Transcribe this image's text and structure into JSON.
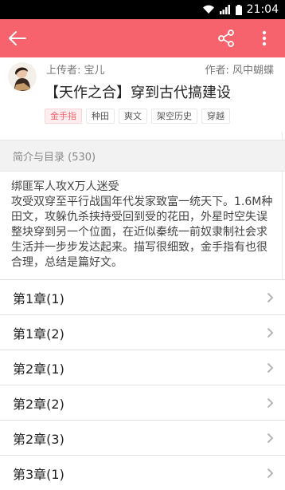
{
  "statusbar": {
    "time": "21:04",
    "icons": [
      "wifi-icon",
      "signal-icon",
      "battery-icon"
    ]
  },
  "appbar": {
    "color": "#f6636d",
    "icons": [
      "back-arrow-icon",
      "share-icon",
      "more-vert-icon"
    ]
  },
  "book": {
    "uploader": "上传者: 宝儿",
    "author": "作者: 风中蝴蝶",
    "title": "【天作之合】穿到古代搞建设",
    "tags": [
      "金手指",
      "种田",
      "爽文",
      "架空历史",
      "穿越"
    ]
  },
  "section": {
    "label": "简介与目录 (530)"
  },
  "description": {
    "first_line": "绑匪军人攻X万人迷受",
    "body": "攻受双穿至平行战国年代发家致富一统天下。1.6M种田文，攻躲仇杀挟持受回到受的花田，外星时空失误整块穿到另一个位面，在近似秦统一前奴隶制社会求生活并一步步发达起来。描写很细致，金手指有也很合理，总结是篇好文。"
  },
  "chapters": [
    {
      "label": "第1章(1)"
    },
    {
      "label": "第1章(2)"
    },
    {
      "label": "第2章(1)"
    },
    {
      "label": "第2章(2)"
    },
    {
      "label": "第2章(3)"
    },
    {
      "label": "第3章(1)"
    }
  ]
}
